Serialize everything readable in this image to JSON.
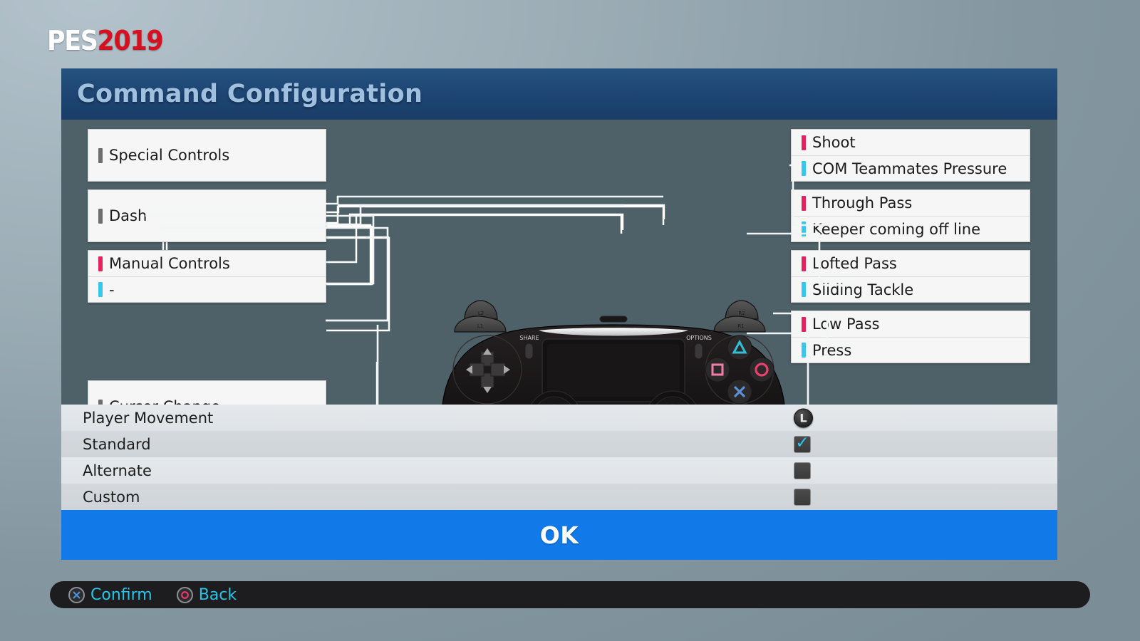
{
  "logo": {
    "part1": "PES",
    "part2": "2019"
  },
  "window": {
    "title": "Command Configuration"
  },
  "left_cards": [
    {
      "rows": [
        {
          "bar": "grey",
          "label": "Special Controls"
        }
      ]
    },
    {
      "rows": [
        {
          "bar": "grey",
          "label": "Dash"
        }
      ]
    },
    {
      "rows": [
        {
          "bar": "pink",
          "label": "Manual Controls"
        },
        {
          "bar": "cyan",
          "label": "-"
        }
      ]
    },
    {
      "rows": [
        {
          "bar": "grey",
          "label": "Cursor Change"
        }
      ]
    }
  ],
  "right_cards": [
    {
      "rows": [
        {
          "bar": "pink",
          "label": "Shoot"
        },
        {
          "bar": "cyan",
          "label": "COM Teammates Pressure"
        }
      ]
    },
    {
      "rows": [
        {
          "bar": "pink",
          "label": "Through Pass"
        },
        {
          "bar": "cyan",
          "label": "Keeper coming off line"
        }
      ]
    },
    {
      "rows": [
        {
          "bar": "pink",
          "label": "Lofted Pass"
        },
        {
          "bar": "cyan",
          "label": "Sliding Tackle"
        }
      ]
    },
    {
      "rows": [
        {
          "bar": "pink",
          "label": "Low Pass"
        },
        {
          "bar": "cyan",
          "label": "Press"
        }
      ]
    }
  ],
  "controller": {
    "labels": {
      "l1": "L1",
      "l2": "L2",
      "r1": "R1",
      "r2": "R2",
      "share": "SHARE",
      "options": "OPTIONS"
    },
    "face_buttons": [
      {
        "name": "triangle",
        "color": "#2fc0d8"
      },
      {
        "name": "circle",
        "color": "#e8406f"
      },
      {
        "name": "cross",
        "color": "#5b8fd6"
      },
      {
        "name": "square",
        "color": "#ef7fa8"
      }
    ]
  },
  "list": {
    "rows": [
      {
        "label": "Player Movement",
        "control": "l-stick-button",
        "control_label": "L",
        "checked": false
      },
      {
        "label": "Standard",
        "control": "checkbox",
        "checked": true
      },
      {
        "label": "Alternate",
        "control": "checkbox",
        "checked": false
      },
      {
        "label": "Custom",
        "control": "checkbox",
        "checked": false
      }
    ]
  },
  "ok_button": {
    "label": "OK"
  },
  "footer": {
    "actions": [
      {
        "icon": "cross-button-icon",
        "label": "Confirm"
      },
      {
        "icon": "circle-button-icon",
        "label": "Back"
      }
    ]
  },
  "colors": {
    "accent_pink": "#e8215e",
    "accent_cyan": "#36c7ef",
    "title_bar": "#1d4472",
    "ok_blue": "#1179e8",
    "stage_bg": "#4e6168",
    "footer_cyan": "#29c3e8",
    "logo_red": "#d7101f"
  }
}
